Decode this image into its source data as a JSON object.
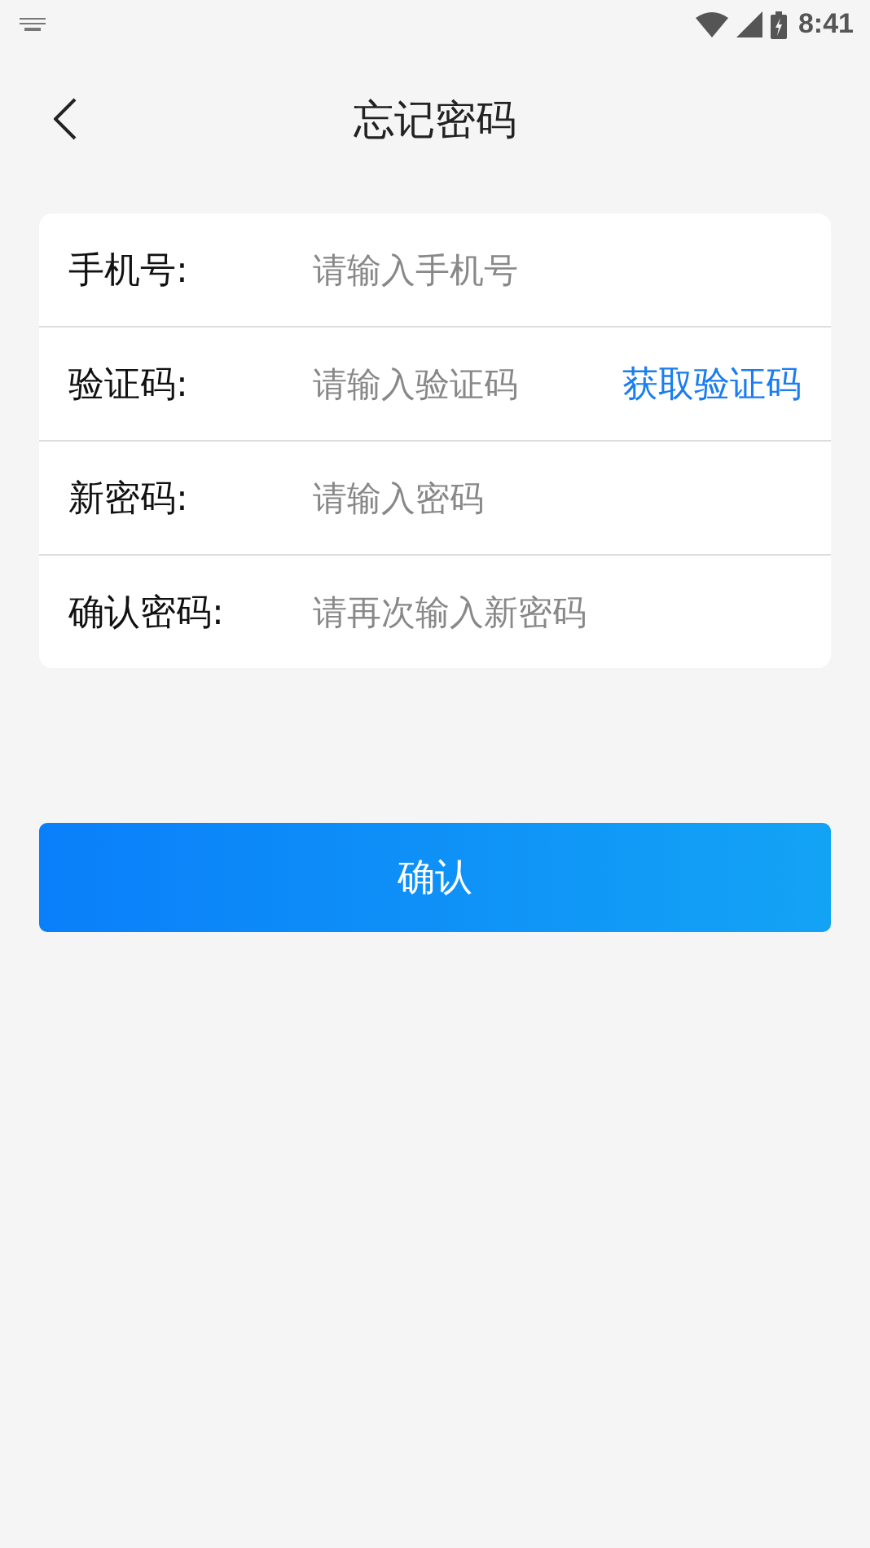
{
  "status_bar": {
    "time": "8:41"
  },
  "header": {
    "title": "忘记密码"
  },
  "fields": [
    {
      "label": "手机号:",
      "placeholder": "请输入手机号"
    },
    {
      "label": "验证码:",
      "placeholder": "请输入验证码",
      "action": "获取验证码"
    },
    {
      "label": "新密码:",
      "placeholder": "请输入密码"
    },
    {
      "label": "确认密码:",
      "placeholder": "请再次输入新密码"
    }
  ],
  "submit": "确认"
}
